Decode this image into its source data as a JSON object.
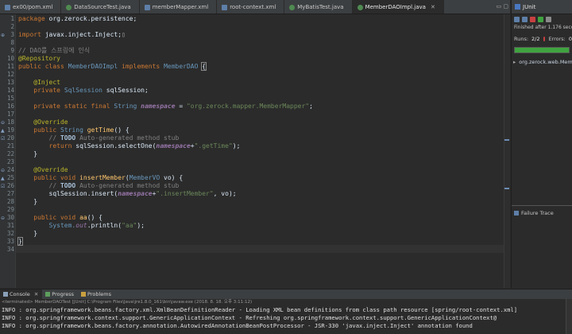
{
  "tabs": [
    {
      "label": "ex00/pom.xml",
      "kind": "xml"
    },
    {
      "label": "DataSourceTest.java",
      "kind": "java"
    },
    {
      "label": "memberMapper.xml",
      "kind": "xml"
    },
    {
      "label": "root-context.xml",
      "kind": "xml"
    },
    {
      "label": "MyBatisTest.java",
      "kind": "java"
    },
    {
      "label": "MemberDAOImpl.java",
      "kind": "java",
      "active": true
    }
  ],
  "editor": {
    "line_numbers": [
      "1",
      "2",
      "3",
      "8",
      "9",
      "10",
      "11",
      "12",
      "13",
      "14",
      "15",
      "16",
      "17",
      "18",
      "19",
      "20",
      "21",
      "22",
      "23",
      "24",
      "25",
      "26",
      "27",
      "28",
      "29",
      "30",
      "31",
      "32",
      "33",
      "34"
    ],
    "current_line": "33"
  },
  "code": {
    "l1": {
      "kw": "package",
      "rest": " org.zerock.persistence;"
    },
    "l3": {
      "kw": "import",
      "rest": " javax.inject.Inject;"
    },
    "l9": {
      "text": "// DAO를 스프링에 인식"
    },
    "l10": {
      "ann": "@Repository"
    },
    "l11": {
      "kw1": "public class",
      "cls": "MemberDAOImpl",
      "kw2": "implements",
      "iface": "MemberDAO",
      "brace": "{"
    },
    "l13": {
      "ann": "@Inject"
    },
    "l14": {
      "kw": "private",
      "type": "SqlSession",
      "rest": " sqlSession;"
    },
    "l16": {
      "kw": "private static final",
      "type": "String",
      "field": "namespace",
      "eq": " = ",
      "str": "\"org.zerock.mapper.MemberMapper\"",
      "end": ";"
    },
    "l18": {
      "ann": "@Override"
    },
    "l19": {
      "kw": "public",
      "type": "String",
      "fn": "getTime",
      "rest": "() {"
    },
    "l20": {
      "cm1": "// ",
      "todo": "TODO",
      "cm2": " Auto-generated method stub"
    },
    "l21": {
      "kw": "return",
      "pre": " sqlSession.selectOne(",
      "field": "namespace",
      "plus": "+",
      "str": "\".getTime\"",
      "end": ");"
    },
    "l22": {
      "text": "}"
    },
    "l24": {
      "ann": "@Override"
    },
    "l25": {
      "kw": "public void",
      "fn": "insertMember",
      "open": "(",
      "type": "MemberVO",
      "rest": " vo) {"
    },
    "l26": {
      "cm1": "// ",
      "todo": "TODO",
      "cm2": " Auto-generated method stub"
    },
    "l27": {
      "pre": "sqlSession.insert(",
      "field": "namespace",
      "plus": "+",
      "str": "\".insertMember\"",
      "end": ", vo);"
    },
    "l28": {
      "text": "}"
    },
    "l30": {
      "kw": "public void",
      "fn": "aa",
      "rest": "() {"
    },
    "l31": {
      "sys": "System.",
      "out": "out",
      "mid": ".println(",
      "str": "\"aa\"",
      "end": ");"
    },
    "l32": {
      "text": "}"
    },
    "l33": {
      "text": "}"
    }
  },
  "junit": {
    "tab_label": "JUnit",
    "finished": "Finished after 1.176 seconds",
    "runs_label": "Runs:",
    "runs_value": "2/2",
    "errors_label": "Errors:",
    "errors_value": "0",
    "progress": 1.0,
    "test_item": "org.zerock.web.MemberDAOTest",
    "failure_trace": "Failure Trace"
  },
  "console": {
    "tabs": [
      "Console",
      "Progress",
      "Problems"
    ],
    "status": "<terminated> MemberDAOTest [JUnit] C:\\Program Files\\Java\\jre1.8.0_161\\bin\\javaw.exe (2018. 8. 18. 오후 3:11:12)",
    "logs": [
      "INFO : org.springframework.beans.factory.xml.XmlBeanDefinitionReader - Loading XML bean definitions from class path resource [spring/root-context.xml]",
      "INFO : org.springframework.context.support.GenericApplicationContext - Refreshing org.springframework.context.support.GenericApplicationContext@",
      "INFO : org.springframework.beans.factory.annotation.AutowiredAnnotationBeanPostProcessor - JSR-330 'javax.inject.Inject' annotation found"
    ]
  },
  "colors": {
    "editor_bg": "#2b2b2b",
    "keyword": "#cc7832",
    "annotation": "#bbb529",
    "string": "#6a8759",
    "comment": "#808080",
    "junit_green": "#3fa33f"
  }
}
